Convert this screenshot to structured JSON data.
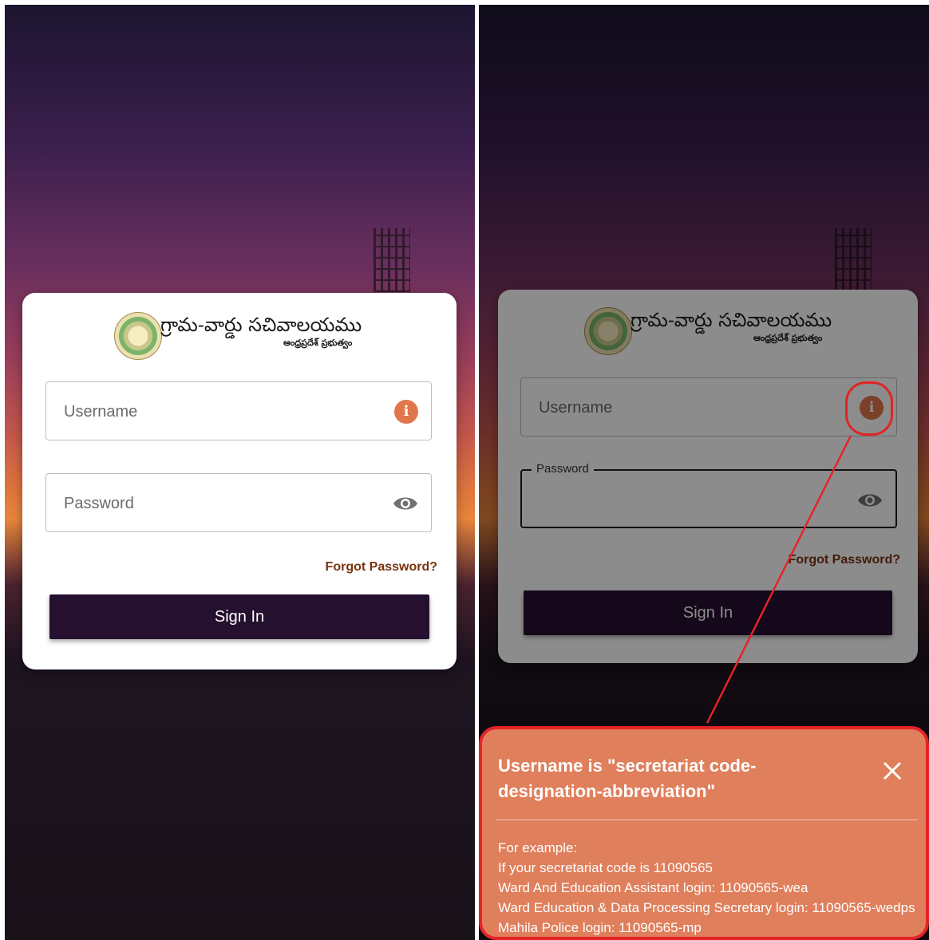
{
  "colors": {
    "accent_orange": "#e0764b",
    "signin_bg": "#261030",
    "forgot_text": "#7a3210",
    "highlight_red": "#e3232a",
    "tooltip_bg": "#e07f5c"
  },
  "logo": {
    "main_text": "గ్రామ-వార్డు సచివాలయము",
    "sub_text": "ఆంధ్రప్రదేశ్ ప్రభుత్వం",
    "emblem_icon": "ap-government-emblem-icon"
  },
  "left": {
    "username": {
      "placeholder": "Username",
      "icon": "info-icon"
    },
    "password": {
      "placeholder": "Password",
      "icon": "eye-icon"
    },
    "forgot": "Forgot Password?",
    "signin": "Sign In"
  },
  "right": {
    "username": {
      "placeholder": "Username",
      "icon": "info-icon"
    },
    "password": {
      "label": "Password",
      "icon": "eye-icon"
    },
    "forgot": "Forgot Password?",
    "signin": "Sign In",
    "tooltip": {
      "title": "Username is \"secretariat code-designation-abbreviation\"",
      "close_icon": "close-icon",
      "lines": [
        "For example:",
        "If your secretariat code is 11090565",
        "Ward And Education Assistant login: 11090565-wea",
        "Ward Education & Data Processing Secretary login: 11090565-wedps",
        "Mahila Police login: 11090565-mp"
      ]
    }
  }
}
